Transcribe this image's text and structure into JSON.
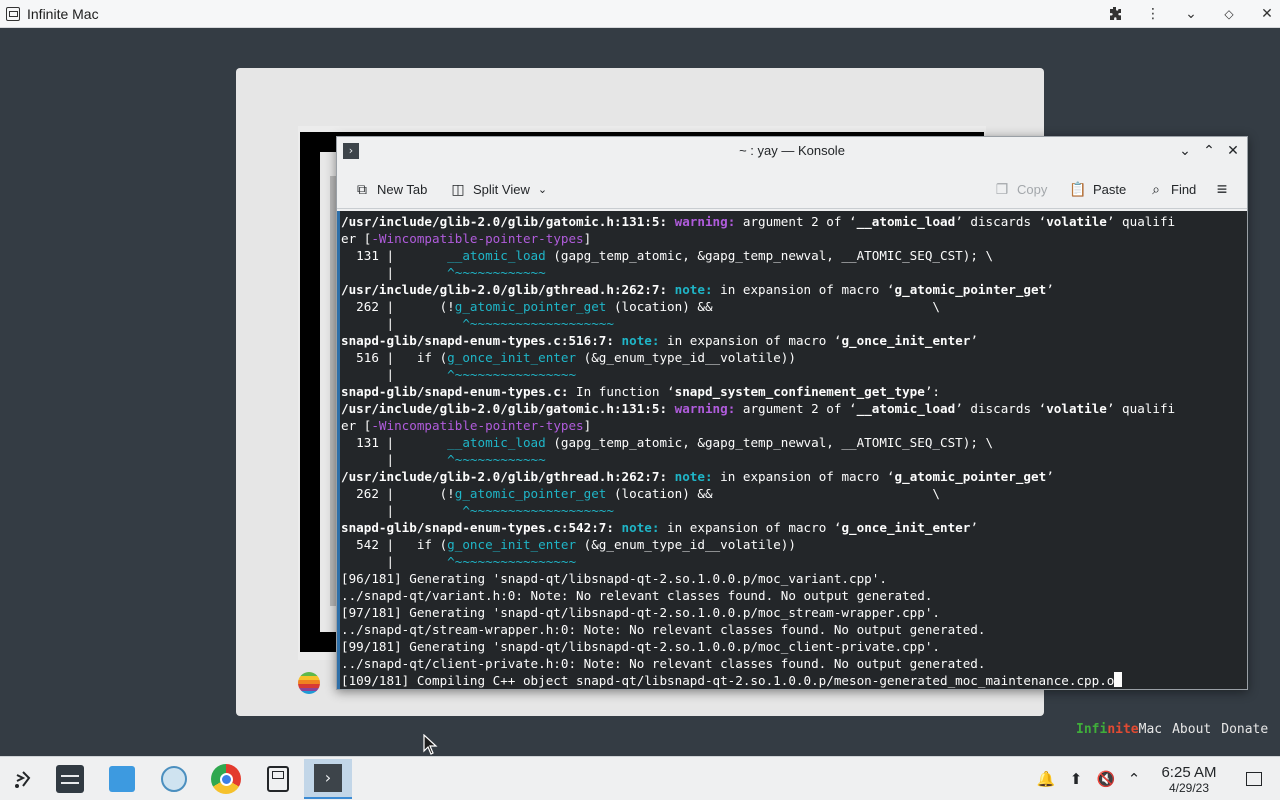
{
  "browser": {
    "title": "Infinite Mac",
    "buttons": [
      "extensions",
      "menu",
      "minimize",
      "restore"
    ]
  },
  "konsole": {
    "title": "~ : yay — Konsole",
    "toolbar": {
      "new_tab": "New Tab",
      "split_view": "Split View",
      "copy": "Copy",
      "paste": "Paste",
      "find": "Find"
    },
    "terminal": [
      [
        {
          "t": "/usr/include/glib-2.0/glib/gatomic.h:131:5: ",
          "c": "b"
        },
        {
          "t": "warning:",
          "c": "warn"
        },
        {
          "t": " argument 2 of ‘"
        },
        {
          "t": "__atomic_load",
          "c": "b"
        },
        {
          "t": "’ discards ‘"
        },
        {
          "t": "volatile",
          "c": "b"
        },
        {
          "t": "’ qualifi"
        }
      ],
      [
        {
          "t": "er ["
        },
        {
          "t": "-Wincompatible-pointer-types",
          "c": "kw"
        },
        {
          "t": "]"
        }
      ],
      [
        {
          "t": "  131 |       "
        },
        {
          "t": "__atomic_load",
          "c": "fn"
        },
        {
          "t": " (gapg_temp_atomic, &gapg_temp_newval, __ATOMIC_SEQ_CST); \\"
        }
      ],
      [
        {
          "t": "      |       "
        },
        {
          "t": "^~~~~~~~~~~~~",
          "c": "caret"
        }
      ],
      [
        {
          "t": "/usr/include/glib-2.0/glib/gthread.h:262:7: ",
          "c": "b"
        },
        {
          "t": "note:",
          "c": "note"
        },
        {
          "t": " in expansion of macro ‘"
        },
        {
          "t": "g_atomic_pointer_get",
          "c": "b"
        },
        {
          "t": "’"
        }
      ],
      [
        {
          "t": "  262 |      (!"
        },
        {
          "t": "g_atomic_pointer_get",
          "c": "fn"
        },
        {
          "t": " (location) &&                             \\"
        }
      ],
      [
        {
          "t": "      |         "
        },
        {
          "t": "^~~~~~~~~~~~~~~~~~~~",
          "c": "caret"
        }
      ],
      [
        {
          "t": "snapd-glib/snapd-enum-types.c:516:7: ",
          "c": "b"
        },
        {
          "t": "note:",
          "c": "note"
        },
        {
          "t": " in expansion of macro ‘"
        },
        {
          "t": "g_once_init_enter",
          "c": "b"
        },
        {
          "t": "’"
        }
      ],
      [
        {
          "t": "  516 |   if ("
        },
        {
          "t": "g_once_init_enter",
          "c": "fn"
        },
        {
          "t": " (&g_enum_type_id__volatile))"
        }
      ],
      [
        {
          "t": "      |       "
        },
        {
          "t": "^~~~~~~~~~~~~~~~~",
          "c": "caret"
        }
      ],
      [
        {
          "t": "snapd-glib/snapd-enum-types.c:",
          "c": "b"
        },
        {
          "t": " In function ‘"
        },
        {
          "t": "snapd_system_confinement_get_type",
          "c": "b"
        },
        {
          "t": "’:"
        }
      ],
      [
        {
          "t": "/usr/include/glib-2.0/glib/gatomic.h:131:5: ",
          "c": "b"
        },
        {
          "t": "warning:",
          "c": "warn"
        },
        {
          "t": " argument 2 of ‘"
        },
        {
          "t": "__atomic_load",
          "c": "b"
        },
        {
          "t": "’ discards ‘"
        },
        {
          "t": "volatile",
          "c": "b"
        },
        {
          "t": "’ qualifi"
        }
      ],
      [
        {
          "t": "er ["
        },
        {
          "t": "-Wincompatible-pointer-types",
          "c": "kw"
        },
        {
          "t": "]"
        }
      ],
      [
        {
          "t": "  131 |       "
        },
        {
          "t": "__atomic_load",
          "c": "fn"
        },
        {
          "t": " (gapg_temp_atomic, &gapg_temp_newval, __ATOMIC_SEQ_CST); \\"
        }
      ],
      [
        {
          "t": "      |       "
        },
        {
          "t": "^~~~~~~~~~~~~",
          "c": "caret"
        }
      ],
      [
        {
          "t": "/usr/include/glib-2.0/glib/gthread.h:262:7: ",
          "c": "b"
        },
        {
          "t": "note:",
          "c": "note"
        },
        {
          "t": " in expansion of macro ‘"
        },
        {
          "t": "g_atomic_pointer_get",
          "c": "b"
        },
        {
          "t": "’"
        }
      ],
      [
        {
          "t": "  262 |      (!"
        },
        {
          "t": "g_atomic_pointer_get",
          "c": "fn"
        },
        {
          "t": " (location) &&                             \\"
        }
      ],
      [
        {
          "t": "      |         "
        },
        {
          "t": "^~~~~~~~~~~~~~~~~~~~",
          "c": "caret"
        }
      ],
      [
        {
          "t": "snapd-glib/snapd-enum-types.c:542:7: ",
          "c": "b"
        },
        {
          "t": "note:",
          "c": "note"
        },
        {
          "t": " in expansion of macro ‘"
        },
        {
          "t": "g_once_init_enter",
          "c": "b"
        },
        {
          "t": "’"
        }
      ],
      [
        {
          "t": "  542 |   if ("
        },
        {
          "t": "g_once_init_enter",
          "c": "fn"
        },
        {
          "t": " (&g_enum_type_id__volatile))"
        }
      ],
      [
        {
          "t": "      |       "
        },
        {
          "t": "^~~~~~~~~~~~~~~~~",
          "c": "caret"
        }
      ],
      [
        {
          "t": "[96/181] Generating 'snapd-qt/libsnapd-qt-2.so.1.0.0.p/moc_variant.cpp'."
        }
      ],
      [
        {
          "t": "../snapd-qt/variant.h:0: Note: No relevant classes found. No output generated."
        }
      ],
      [
        {
          "t": "[97/181] Generating 'snapd-qt/libsnapd-qt-2.so.1.0.0.p/moc_stream-wrapper.cpp'."
        }
      ],
      [
        {
          "t": "../snapd-qt/stream-wrapper.h:0: Note: No relevant classes found. No output generated."
        }
      ],
      [
        {
          "t": "[99/181] Generating 'snapd-qt/libsnapd-qt-2.so.1.0.0.p/moc_client-private.cpp'."
        }
      ],
      [
        {
          "t": "../snapd-qt/client-private.h:0: Note: No relevant classes found. No output generated."
        }
      ],
      [
        {
          "t": "[109/181] Compiling C++ object snapd-qt/libsnapd-qt-2.so.1.0.0.p/meson-generated_moc_maintenance.cpp.o"
        },
        {
          "t": "",
          "c": "cursor"
        }
      ]
    ]
  },
  "footer": {
    "brand_part1": "Infi",
    "brand_part2": "nite",
    "brand_part3": " Mac",
    "about": "About",
    "donate": "Donate"
  },
  "taskbar": {
    "apps": [
      "application-launcher",
      "system-settings",
      "discover-store",
      "plasma-app",
      "chrome",
      "infinite-mac",
      "konsole"
    ],
    "active_app": "konsole",
    "clock_time": "6:25 AM",
    "clock_date": "4/29/23"
  }
}
